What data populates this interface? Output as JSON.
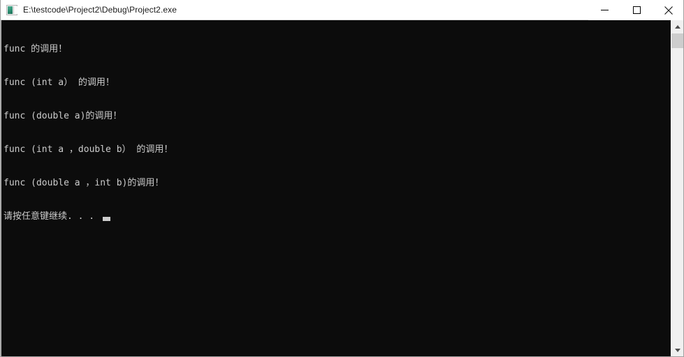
{
  "window": {
    "title": "E:\\testcode\\Project2\\Debug\\Project2.exe",
    "icon": "console-app-icon",
    "controls": {
      "minimize_label": "—",
      "maximize_label": "□",
      "close_label": "✕"
    }
  },
  "console": {
    "background_color": "#0c0c0c",
    "text_color": "#cccccc",
    "lines": [
      "func 的调用！",
      "func (int a） 的调用！",
      "func (double a)的调用！",
      "func (int a ，double b） 的调用！",
      "func (double a ，int b)的调用！"
    ],
    "prompt_line": "请按任意键继续. . . ",
    "cursor": "block-cursor"
  },
  "scrollbar": {
    "up_arrow": "chevron-up-icon",
    "down_arrow": "chevron-down-icon",
    "thumb": "scrollbar-thumb"
  }
}
